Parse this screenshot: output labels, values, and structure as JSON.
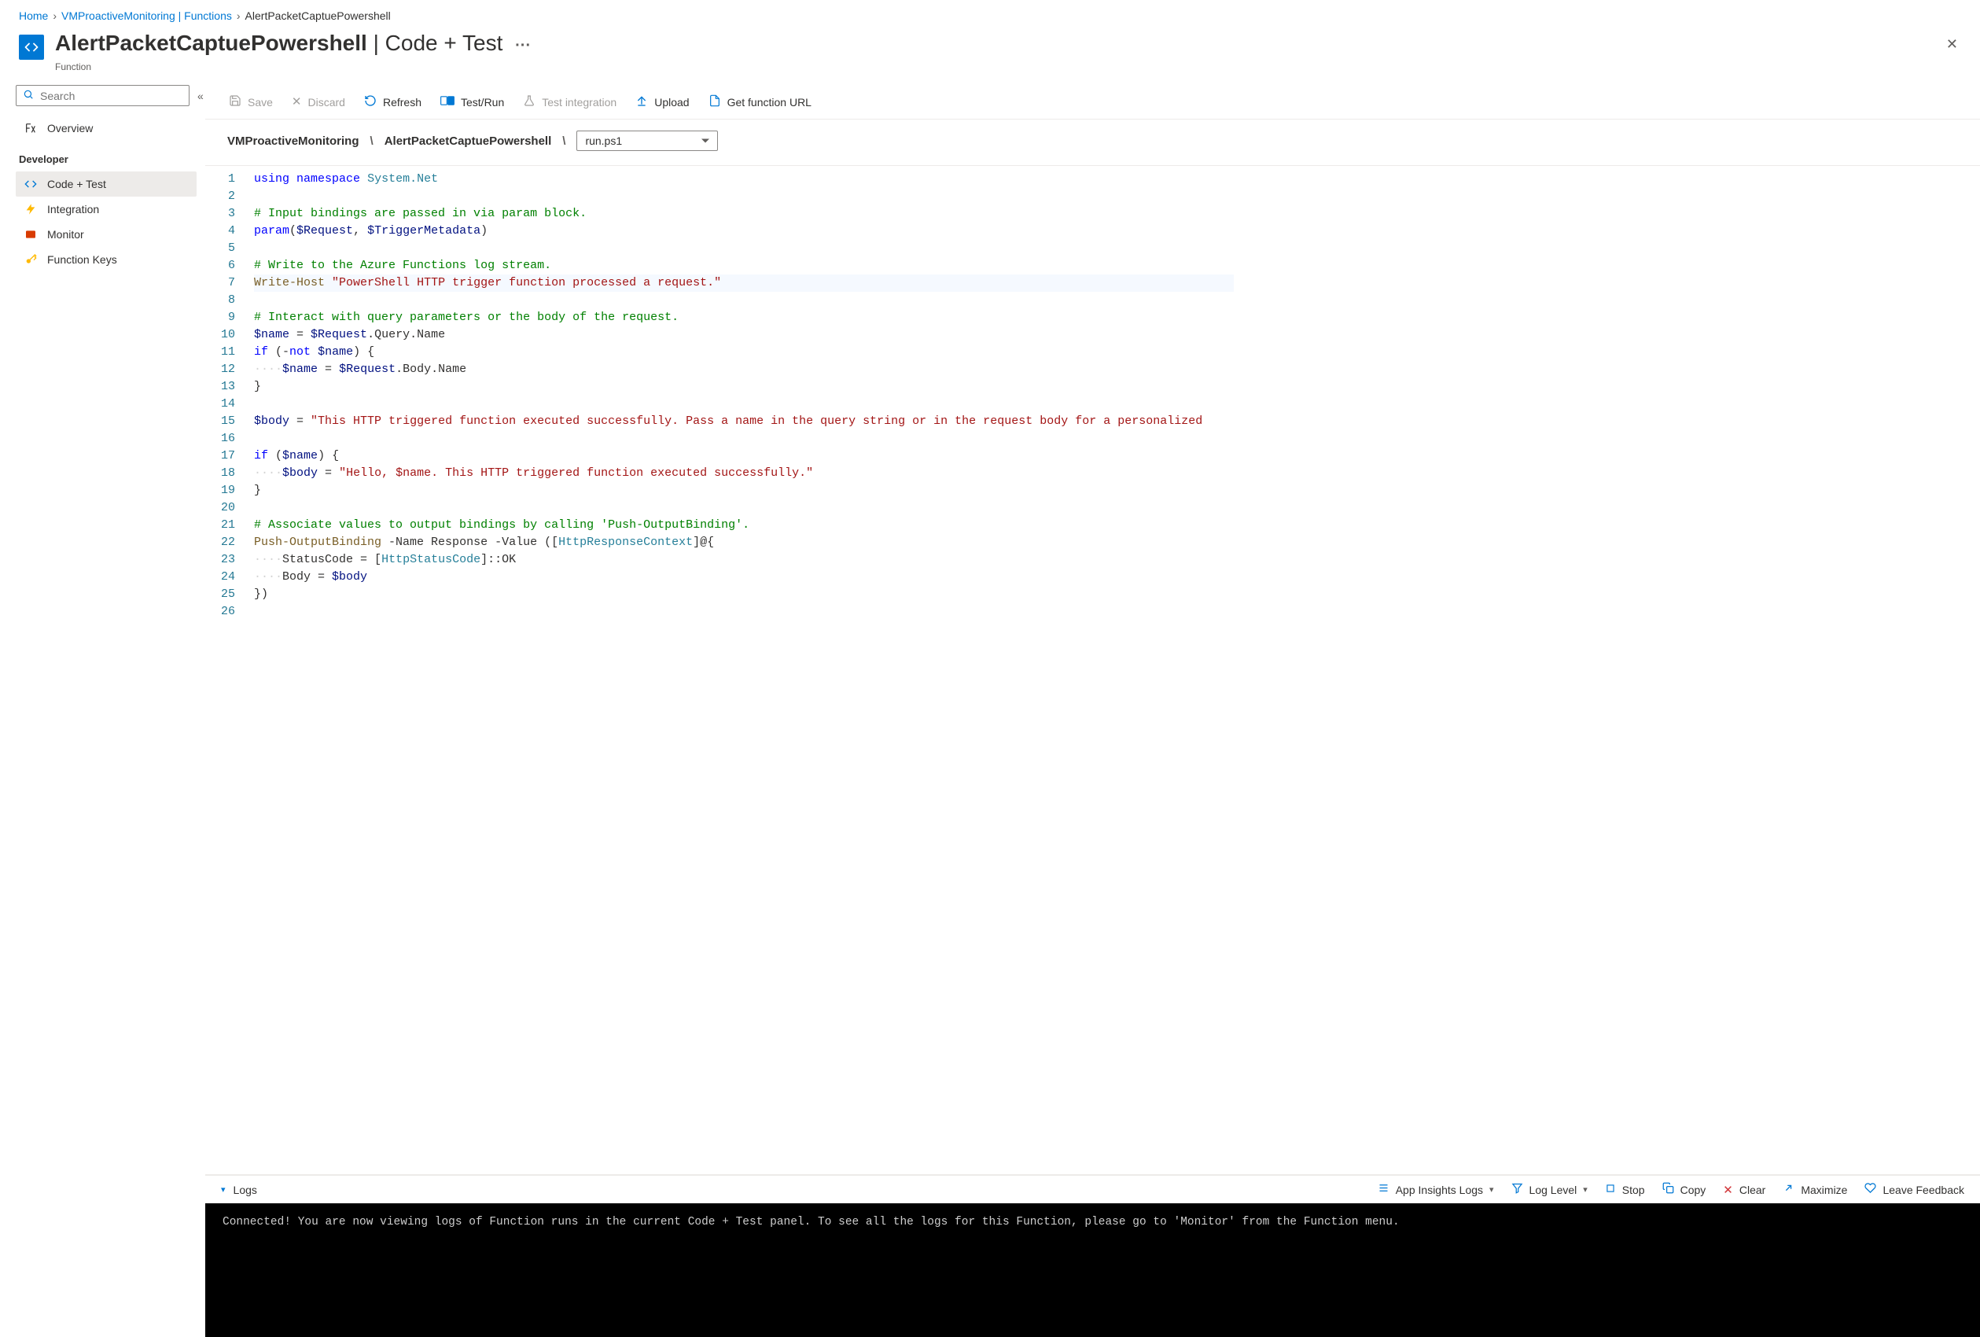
{
  "breadcrumb": {
    "home": "Home",
    "mid": "VMProactiveMonitoring | Functions",
    "current": "AlertPacketCaptuePowershell"
  },
  "header": {
    "title_main": "AlertPacketCaptuePowershell",
    "title_sep": " | ",
    "title_sub": "Code + Test",
    "subtitle": "Function",
    "more": "···",
    "close": "✕"
  },
  "sidebar": {
    "search_placeholder": "Search",
    "collapse": "«",
    "items": [
      {
        "label": "Overview"
      },
      {
        "label": "Code + Test"
      },
      {
        "label": "Integration"
      },
      {
        "label": "Monitor"
      },
      {
        "label": "Function Keys"
      }
    ],
    "group_developer": "Developer"
  },
  "toolbar": {
    "save": "Save",
    "discard": "Discard",
    "refresh": "Refresh",
    "testrun": "Test/Run",
    "testint": "Test integration",
    "upload": "Upload",
    "geturl": "Get function URL"
  },
  "path": {
    "seg1": "VMProactiveMonitoring",
    "seg2": "AlertPacketCaptuePowershell",
    "file": "run.ps1"
  },
  "code": {
    "lines": [
      [
        [
          "kw",
          "using"
        ],
        [
          "",
          " "
        ],
        [
          "kw",
          "namespace"
        ],
        [
          "",
          " "
        ],
        [
          "ty",
          "System.Net"
        ]
      ],
      [],
      [
        [
          "cm",
          "# Input bindings are passed in via param block."
        ]
      ],
      [
        [
          "kw",
          "param"
        ],
        [
          "",
          "("
        ],
        [
          "va",
          "$Request"
        ],
        [
          "",
          ", "
        ],
        [
          "va",
          "$TriggerMetadata"
        ],
        [
          "",
          ")"
        ]
      ],
      [],
      [
        [
          "cm",
          "# Write to the Azure Functions log stream."
        ]
      ],
      [
        [
          "fn",
          "Write-Host"
        ],
        [
          "",
          " "
        ],
        [
          "st",
          "\"PowerShell HTTP trigger function processed a request.\""
        ]
      ],
      [],
      [
        [
          "cm",
          "# Interact with query parameters or the body of the request."
        ]
      ],
      [
        [
          "va",
          "$name"
        ],
        [
          "",
          " = "
        ],
        [
          "va",
          "$Request"
        ],
        [
          "",
          ".Query.Name"
        ]
      ],
      [
        [
          "kw",
          "if"
        ],
        [
          "",
          " (-"
        ],
        [
          "kw",
          "not"
        ],
        [
          "",
          " "
        ],
        [
          "va",
          "$name"
        ],
        [
          "",
          ") {"
        ]
      ],
      [
        [
          "dot",
          "····"
        ],
        [
          "va",
          "$name"
        ],
        [
          "",
          " = "
        ],
        [
          "va",
          "$Request"
        ],
        [
          "",
          ".Body.Name"
        ]
      ],
      [
        [
          "",
          "}"
        ]
      ],
      [],
      [
        [
          "va",
          "$body"
        ],
        [
          "",
          " = "
        ],
        [
          "st",
          "\"This HTTP triggered function executed successfully. Pass a name in the query string or in the request body for a personalized"
        ]
      ],
      [],
      [
        [
          "kw",
          "if"
        ],
        [
          "",
          " ("
        ],
        [
          "va",
          "$name"
        ],
        [
          "",
          ") {"
        ]
      ],
      [
        [
          "dot",
          "····"
        ],
        [
          "va",
          "$body"
        ],
        [
          "",
          " = "
        ],
        [
          "st",
          "\"Hello, $name. This HTTP triggered function executed successfully.\""
        ]
      ],
      [
        [
          "",
          "}"
        ]
      ],
      [],
      [
        [
          "cm",
          "# Associate values to output bindings by calling 'Push-OutputBinding'."
        ]
      ],
      [
        [
          "fn",
          "Push-OutputBinding"
        ],
        [
          "",
          " -Name Response -Value (["
        ],
        [
          "ty",
          "HttpResponseContext"
        ],
        [
          "",
          "]@{"
        ]
      ],
      [
        [
          "dot",
          "····"
        ],
        [
          "",
          "StatusCode = ["
        ],
        [
          "ty",
          "HttpStatusCode"
        ],
        [
          "",
          "]::OK"
        ]
      ],
      [
        [
          "dot",
          "····"
        ],
        [
          "",
          "Body = "
        ],
        [
          "va",
          "$body"
        ]
      ],
      [
        [
          "",
          "})"
        ]
      ],
      []
    ],
    "current_line": 7
  },
  "logsbar": {
    "logs": "Logs",
    "appinsights": "App Insights Logs",
    "loglevel": "Log Level",
    "stop": "Stop",
    "copy": "Copy",
    "clear": "Clear",
    "maximize": "Maximize",
    "feedback": "Leave Feedback"
  },
  "console": {
    "text": "Connected! You are now viewing logs of Function runs in the current Code + Test panel. To see all the logs for this Function, please go to 'Monitor' from the Function menu."
  }
}
